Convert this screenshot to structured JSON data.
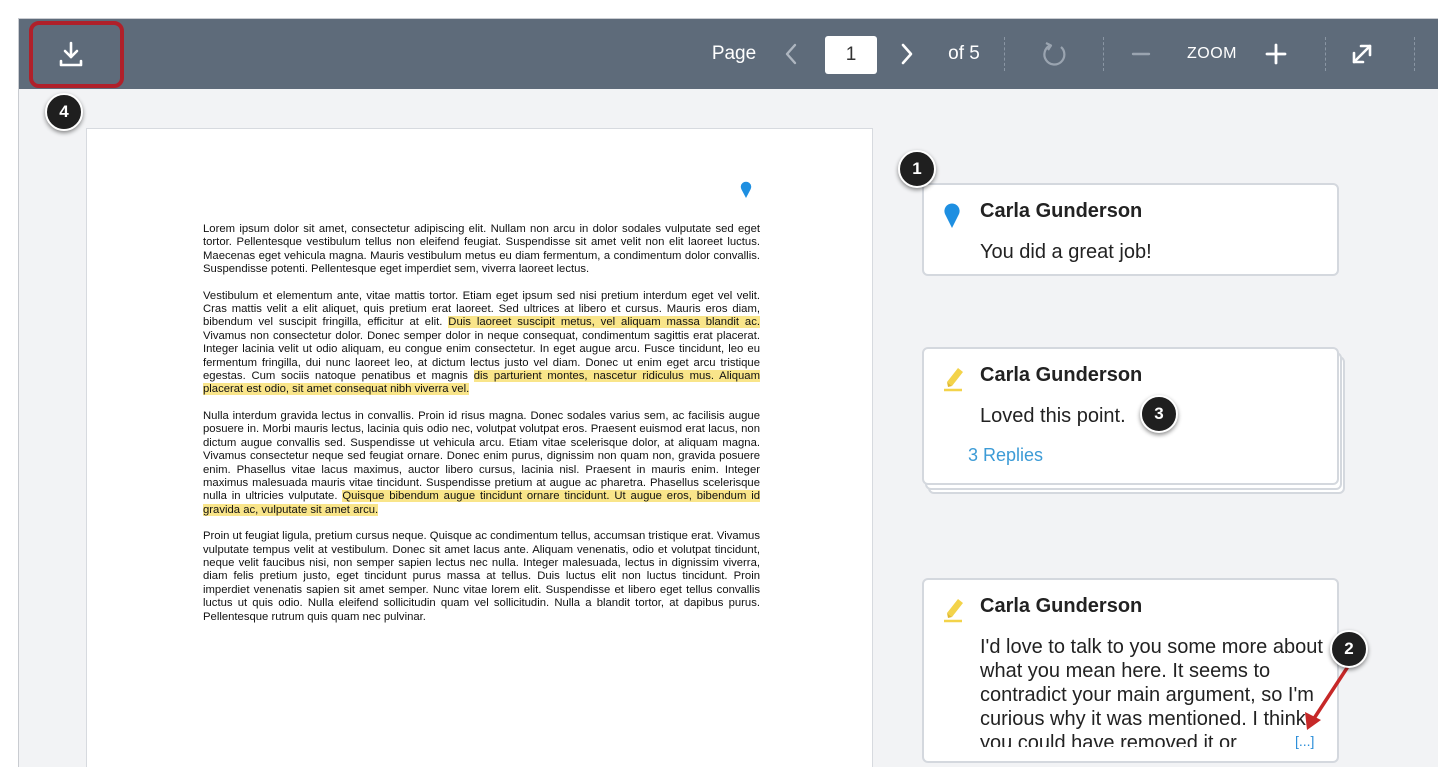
{
  "toolbar": {
    "download_icon": "download-icon",
    "page_label": "Page",
    "prev_icon": "chevron-left-icon",
    "page_value": "1",
    "next_icon": "chevron-right-icon",
    "of_label": "of 5",
    "rotate_icon": "rotate-icon",
    "zoom_out_icon": "minus-icon",
    "zoom_label": "ZOOM",
    "zoom_in_icon": "plus-icon",
    "fullscreen_icon": "expand-icon"
  },
  "badges": {
    "b1": "1",
    "b2": "2",
    "b3": "3",
    "b4": "4"
  },
  "document": {
    "p1": "Lorem ipsum dolor sit amet, consectetur adipiscing elit. Nullam non arcu in dolor sodales vulputate sed eget tortor. Pellentesque vestibulum tellus non eleifend feugiat. Suspendisse sit amet velit non elit laoreet luctus. Maecenas eget vehicula magna. Mauris vestibulum metus eu diam fermentum, a condimentum dolor convallis. Suspendisse potenti. Pellentesque eget imperdiet sem, viverra laoreet lectus.",
    "p2a": "Vestibulum et elementum ante, vitae mattis tortor. Etiam eget ipsum sed nisi pretium interdum eget vel velit. Cras mattis velit a elit aliquet, quis pretium erat laoreet. Sed ultrices at libero et cursus. Mauris eros diam, bibendum vel suscipit fringilla, efficitur at elit. ",
    "p2_hl1": "Duis laoreet suscipit metus, vel aliquam massa blandit ac.",
    "p2b": " Vivamus non consectetur dolor. Donec semper dolor in neque consequat, condimentum sagittis erat placerat. Integer lacinia velit ut odio aliquam, eu congue enim consectetur. In eget augue arcu. Fusce tincidunt, leo eu fermentum fringilla, dui nunc laoreet leo, at dictum lectus justo vel diam. Donec ut enim eget arcu tristique egestas. Cum sociis natoque penatibus et magnis ",
    "p2_hl2": "dis parturient montes, nascetur ridiculus mus. Aliquam placerat est odio, sit amet consequat nibh viverra vel.",
    "p3a": "Nulla interdum gravida lectus in convallis. Proin id risus magna. Donec sodales varius sem, ac facilisis augue posuere in. Morbi mauris lectus, lacinia quis odio nec, volutpat volutpat eros. Praesent euismod erat lacus, non dictum augue convallis sed. Suspendisse ut vehicula arcu. Etiam vitae scelerisque dolor, at aliquam magna. Vivamus consectetur neque sed feugiat ornare. Donec enim purus, dignissim non quam non, gravida posuere enim. Phasellus vitae lacus maximus, auctor libero cursus, lacinia nisl. Praesent in mauris enim. Integer maximus malesuada mauris vitae tincidunt. Suspendisse pretium at augue ac pharetra. Phasellus scelerisque nulla in ultricies vulputate. ",
    "p3_hl": "Quisque bibendum augue tincidunt ornare tincidunt. Ut augue eros, bibendum id gravida ac, vulputate sit amet arcu.",
    "p4": "Proin ut feugiat ligula, pretium cursus neque. Quisque ac condimentum tellus, accumsan tristique erat. Vivamus vulputate tempus velit at vestibulum. Donec sit amet lacus ante. Aliquam venenatis, odio et volutpat tincidunt, neque velit faucibus nisi, non semper sapien lectus nec nulla. Integer malesuada, lectus in dignissim viverra, diam felis pretium justo, eget tincidunt purus massa at tellus. Duis luctus elit non luctus tincidunt. Proin imperdiet venenatis sapien sit amet semper. Nunc vitae lorem elit. Suspendisse et libero eget tellus convallis luctus ut quis odio. Nulla eleifend sollicitudin quam vel sollicitudin. Nulla a blandit tortor, at dapibus purus. Pellentesque rutrum quis quam nec pulvinar."
  },
  "comments": [
    {
      "author": "Carla Gunderson",
      "text": "You did a great job!",
      "icon": "pin-icon",
      "color": "#1e8fe1"
    },
    {
      "author": "Carla Gunderson",
      "text": "Loved this point.",
      "icon": "highlighter-icon",
      "replies": "3 Replies",
      "color": "#f3d34a"
    },
    {
      "author": "Carla Gunderson",
      "text": "I'd love to talk to you some more about what you mean here. It seems to contradict your main argument, so I'm curious why it was mentioned. I think you could have removed it or",
      "icon": "highlighter-icon",
      "more": "[...]",
      "color": "#f3d34a"
    }
  ]
}
